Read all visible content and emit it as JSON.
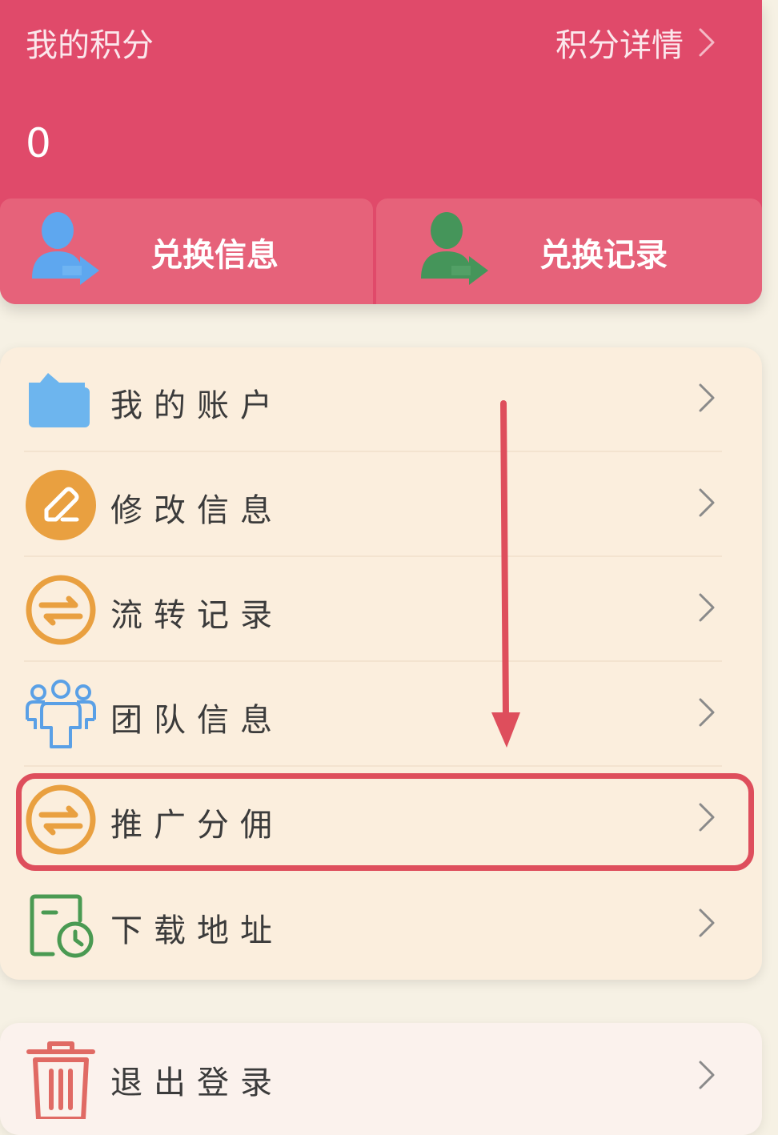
{
  "points": {
    "title": "我的积分",
    "detail_label": "积分详情",
    "value": "0"
  },
  "exchange": {
    "info_label": "兑换信息",
    "record_label": "兑换记录"
  },
  "menu": {
    "items": [
      {
        "label": "我的账户",
        "icon": "folder-icon"
      },
      {
        "label": "修改信息",
        "icon": "edit-icon"
      },
      {
        "label": "流转记录",
        "icon": "transfer-icon"
      },
      {
        "label": "团队信息",
        "icon": "team-icon"
      },
      {
        "label": "推广分佣",
        "icon": "transfer-icon"
      },
      {
        "label": "下载地址",
        "icon": "download-clock-icon"
      }
    ]
  },
  "logout": {
    "label": "退出登录",
    "icon": "trash-icon"
  },
  "colors": {
    "header_bg": "#e04a6a",
    "exchange_bg": "#e6627a",
    "menu_bg": "#fbeedd",
    "highlight": "#de4e5c",
    "orange": "#e9a040",
    "blue": "#66b2ee",
    "green": "#4a9a52"
  }
}
